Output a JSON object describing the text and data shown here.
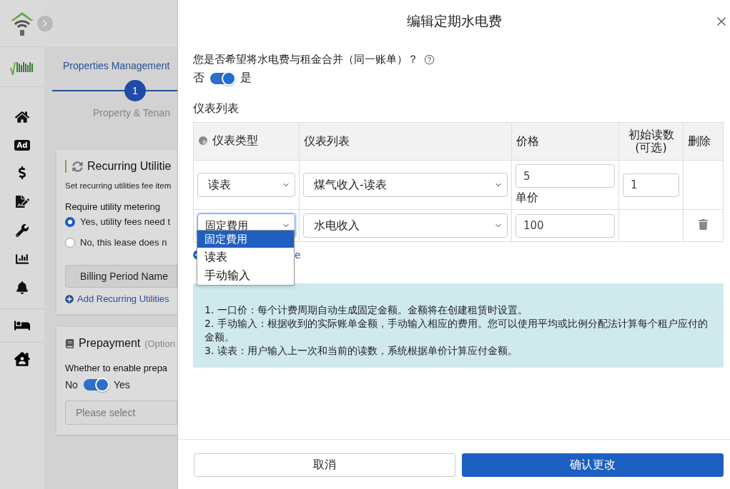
{
  "sidebar": {
    "ad_badge": "Ad"
  },
  "background_page": {
    "breadcrumb": "Properties Management",
    "step": {
      "number": "1",
      "label": "Property & Tenan"
    },
    "utilities_card": {
      "title": "Recurring Utilitie",
      "description": "Set recurring utilities fee item",
      "question": "Require utility metering",
      "options": [
        {
          "label": "Yes, utility fees need t",
          "selected": true
        },
        {
          "label": "No, this lease does n",
          "selected": false
        }
      ],
      "column_header": "Billing Period Name",
      "add_link": "Add Recurring Utilities"
    },
    "prepayment_card": {
      "title": "Prepayment",
      "subtitle": "(Option",
      "question": "Whether to enable prepa",
      "toggle": {
        "off_label": "No",
        "on_label": "Yes",
        "on": true
      },
      "select": {
        "placeholder": "Please select"
      }
    }
  },
  "dialog": {
    "title": "编辑定期水电费",
    "merge_question": "您是否希望将水电费与租金合并（同一账单）？",
    "merge_toggle": {
      "off_label": "否",
      "on_label": "是",
      "on": true
    },
    "meter_list_label": "仪表列表",
    "table": {
      "columns": [
        "仪表类型",
        "仪表列表",
        "价格",
        "初始读数\n(可选)",
        "删除"
      ],
      "rows": [
        {
          "meter_type": "读表",
          "meter": "煤气收入-读表",
          "price": "5",
          "price_note": "单价",
          "initial_reading": "1",
          "deletable": false,
          "focused": false
        },
        {
          "meter_type": "固定費用",
          "meter": "水电收入",
          "price": "100",
          "deletable": true,
          "focused": true
        }
      ]
    },
    "dropdown": {
      "options": [
        {
          "label": "固定費用",
          "selected": true
        },
        {
          "label": "读表",
          "selected": false
        },
        {
          "label": "手动输入",
          "selected": false
        }
      ]
    },
    "add_link_fragment": "e",
    "notes": [
      "1. 一口价：每个计费周期自动生成固定金额。金额将在创建租赁时设置。",
      "2. 手动输入：根据收到的实际账单金额，手动输入相应的费用。您可以使用平均或比例分配法计算每个租户应付的金额。",
      "3. 读表：用户输入上一次和当前的读数，系统根据单价计算应付金额。"
    ],
    "buttons": [
      {
        "label": "取消",
        "kind": "secondary"
      },
      {
        "label": "确认更改",
        "kind": "primary"
      }
    ]
  }
}
